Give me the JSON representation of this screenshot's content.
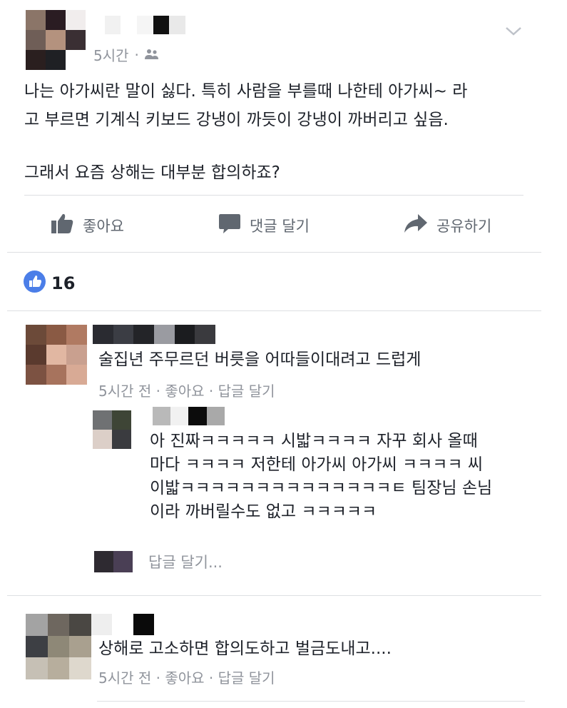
{
  "post": {
    "time": "5시간",
    "separator": "·",
    "audience_icon": "friends-icon",
    "text_line1": "나는 아가씨란 말이 싫다. 특히 사람을 부를때 나한테 아가씨~ 라",
    "text_line2": "고 부르면 기계식 키보드 강냉이 까듯이 강냉이 까버리고 싶음.",
    "text_line3": "그래서 요즘 상해는 대부분 합의하죠?"
  },
  "actions": {
    "like": "좋아요",
    "comment": "댓글 달기",
    "share": "공유하기"
  },
  "reactions": {
    "count": "16"
  },
  "comments": [
    {
      "text": "술집년 주무르던 버릇을 어따들이대려고 드럽게",
      "meta": "5시간 전 · 좋아요 · 답글 달기",
      "reply": {
        "lines": [
          "아 진짜ㅋㅋㅋㅋㅋ 시밟ㅋㅋㅋㅋ 자꾸 회사 올때",
          "마다 ㅋㅋㅋㅋ 저한테 아가씨 아가씨 ㅋㅋㅋㅋ 씨",
          "이밟ㅋㅋㅋㅋㅋㅋㅋㅋㅋㅋㅋㅋㅋㅋㅌ 팀장님 손님",
          "이라 까버릴수도 없고 ㅋㅋㅋㅋㅋ"
        ]
      },
      "reply_placeholder": "답글 달기..."
    },
    {
      "text": "상해로 고소하면 합의도하고 벌금도내고....",
      "meta": "5시간 전 · 좋아요 · 답글 달기"
    }
  ],
  "colors": {
    "accent": "#4267b2",
    "meta": "#90949c",
    "text": "#1d2129",
    "divider": "#dddfe2"
  }
}
